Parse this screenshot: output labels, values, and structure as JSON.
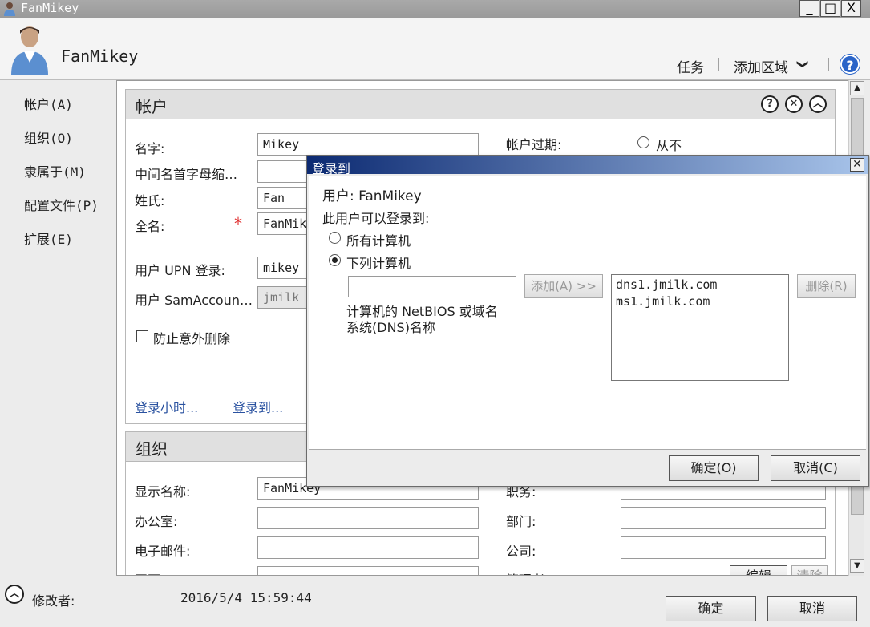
{
  "window": {
    "title": "FanMikey",
    "min_glyph": "_",
    "max_glyph": "□",
    "close_glyph": "X"
  },
  "header": {
    "name": "FanMikey",
    "tasks": "任务",
    "separator": "|",
    "add_area": "添加区域",
    "chevron": "❯",
    "help": "?"
  },
  "nav": [
    {
      "label": "帐户(A)"
    },
    {
      "label": "组织(O)"
    },
    {
      "label": "隶属于(M)"
    },
    {
      "label": "配置文件(P)"
    },
    {
      "label": "扩展(E)"
    }
  ],
  "account": {
    "title": "帐户",
    "head_icons": [
      "?",
      "✕",
      "︿"
    ],
    "first_name_label": "名字:",
    "first_name": "Mikey",
    "initials_label": "中间名首字母缩…",
    "initials": "",
    "last_name_label": "姓氏:",
    "last_name": "Fan",
    "full_name_label": "全名:",
    "required_mark": "*",
    "full_name": "FanMik",
    "upn_label": "用户 UPN 登录:",
    "upn": "mikey",
    "sam_label": "用户 SamAccoun…",
    "sam": "jmilk",
    "protect_label": "防止意外删除",
    "logon_hours": "登录小时...",
    "logon_to": "登录到...",
    "expiry_label": "帐户过期:",
    "never_label": "从不"
  },
  "organization": {
    "title": "组织",
    "display_name_label": "显示名称:",
    "display_name": "FanMikey",
    "office_label": "办公室:",
    "office": "",
    "email_label": "电子邮件:",
    "email": "",
    "web_label": "网页:",
    "job_title_label": "职务:",
    "job_title": "",
    "department_label": "部门:",
    "department": "",
    "company_label": "公司:",
    "company": "",
    "manager_label": "管理者:",
    "edit_button": "编辑",
    "clear_button": "清除"
  },
  "dialog": {
    "title": "登录到",
    "close_glyph": "✕",
    "user_line": "用户: FanMikey",
    "can_logon_to": "此用户可以登录到:",
    "all_computers": "所有计算机",
    "following_computers": "下列计算机",
    "computer_input": "",
    "add_button": "添加(A) >>",
    "hint_line1": "计算机的 NetBIOS 或域名",
    "hint_line2": "系统(DNS)名称",
    "computers": [
      "dns1.jmilk.com",
      "ms1.jmilk.com"
    ],
    "remove_button": "删除(R)",
    "ok_button": "确定(O)",
    "cancel_button": "取消(C)"
  },
  "footer": {
    "modified_label": "修改者:",
    "modified_time": "2016/5/4 15:59:44",
    "ok_button": "确定",
    "cancel_button": "取消"
  }
}
